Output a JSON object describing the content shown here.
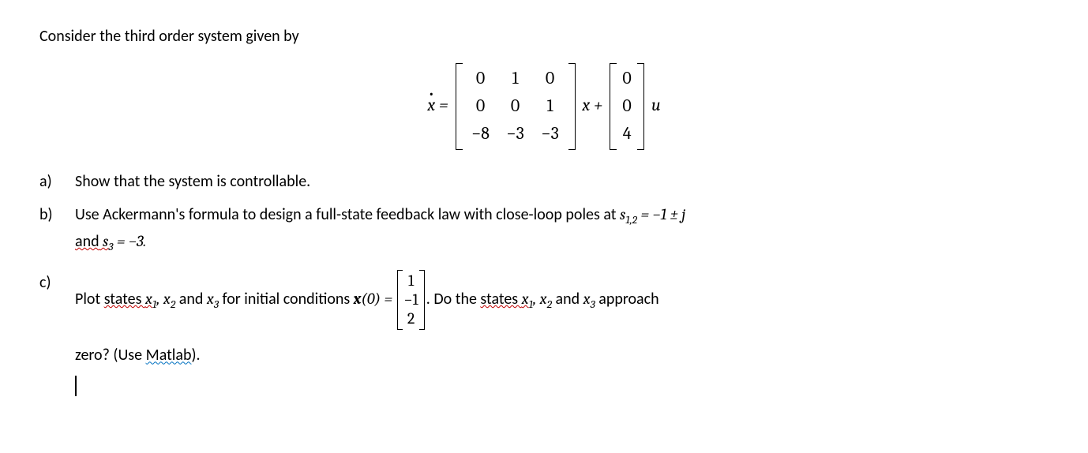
{
  "intro": "Consider the third order system given by",
  "equation": {
    "lhs": "ẋ =",
    "A": [
      [
        "0",
        "1",
        "0"
      ],
      [
        "0",
        "0",
        "1"
      ],
      [
        "−8",
        "−3",
        "−3"
      ]
    ],
    "between1": "x +",
    "B": [
      "0",
      "0",
      "4"
    ],
    "after": "u"
  },
  "items": {
    "a": {
      "label": "a)",
      "text": "Show that the system is controllable."
    },
    "b": {
      "label": "b)",
      "prefix": "Use Ackermann's formula to design a full-state feedback law with close-loop poles at ",
      "s12_lhs": "s",
      "s12_sub": "1,2",
      "s12_eq": " = −1 ± j",
      "line2_pre": "and",
      "line2_under": " s",
      "s3_sub": "3",
      "s3_eq": " =  −3."
    },
    "c": {
      "label": "c)",
      "pre": "Plot ",
      "states_word": "states ",
      "x1": "x",
      "x2": "x",
      "x3": "x",
      "comma": ", ",
      "and_word": " and ",
      "mid": " for initial conditions ",
      "x0_lhs": "x",
      "x0_arg": "(0) = ",
      "x0_vec": [
        "1",
        "−1",
        "2"
      ],
      "post1": ". Do the ",
      "states_word2": "states ",
      "approach": " approach",
      "line2": "zero? (Use ",
      "matlab": "Matlab",
      "line2_end": ")."
    }
  }
}
